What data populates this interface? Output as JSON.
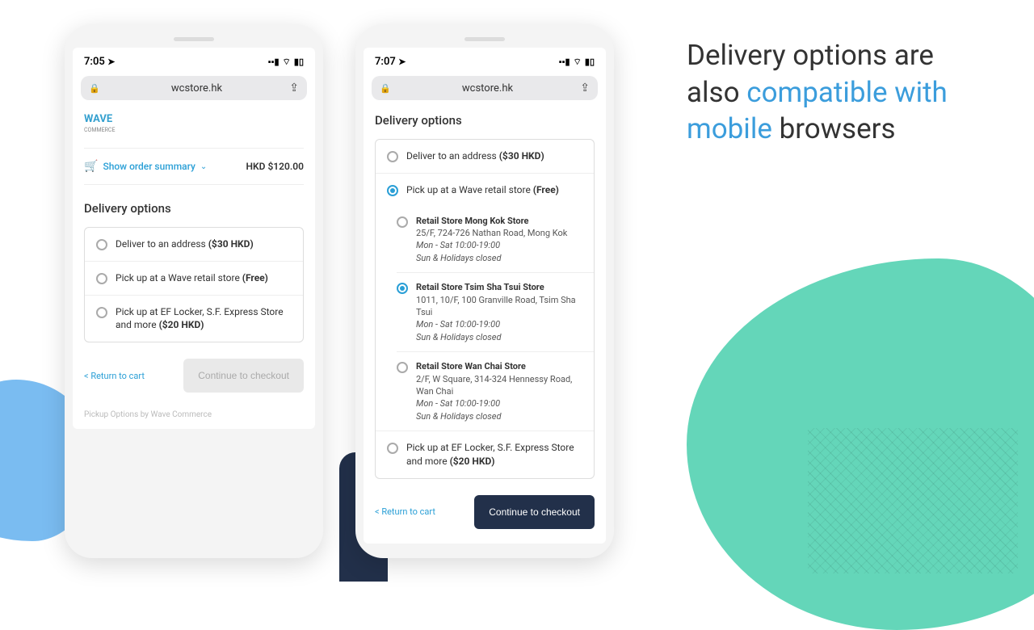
{
  "headline": {
    "part1": "Delivery options are also ",
    "accent": "compatible with mobile",
    "part2": " browsers"
  },
  "phone1": {
    "time": "7:05",
    "url": "wcstore.hk",
    "logo": "WAVE",
    "logo_sub": "COMMERCE",
    "summary_label": "Show order summary",
    "total": "HKD $120.00",
    "section_title": "Delivery options",
    "options": [
      {
        "label": "Deliver to an address ",
        "price": "($30 HKD)"
      },
      {
        "label": "Pick up at a Wave retail store ",
        "price": "(Free)"
      },
      {
        "label": "Pick up at EF Locker, S.F. Express Store and more ",
        "price": "($20 HKD)"
      }
    ],
    "return_label": "< Return to cart",
    "continue_label": "Continue to checkout",
    "footnote": "Pickup Options by Wave Commerce"
  },
  "phone2": {
    "time": "7:07",
    "url": "wcstore.hk",
    "section_title": "Delivery options",
    "deliver": {
      "label": "Deliver to an address ",
      "price": "($30 HKD)"
    },
    "pickup_wave": {
      "label": "Pick up at a Wave retail store ",
      "price": "(Free)"
    },
    "stores": [
      {
        "name": "Retail Store Mong Kok Store",
        "addr": "25/F, 724-726 Nathan Road, Mong Kok",
        "hours1": "Mon - Sat 10:00-19:00",
        "hours2": "Sun & Holidays closed"
      },
      {
        "name": "Retail Store Tsim Sha Tsui Store",
        "addr": "1011, 10/F, 100 Granville Road, Tsim Sha Tsui",
        "hours1": "Mon - Sat 10:00-19:00",
        "hours2": "Sun & Holidays closed"
      },
      {
        "name": "Retail Store Wan Chai Store",
        "addr": "2/F, W Square, 314-324 Hennessy Road, Wan Chai",
        "hours1": "Mon - Sat 10:00-19:00",
        "hours2": "Sun & Holidays closed"
      }
    ],
    "selected_store_index": 1,
    "ef_locker": {
      "label": "Pick up at EF Locker, S.F. Express Store and more ",
      "price": "($20 HKD)"
    },
    "return_label": "< Return to cart",
    "continue_label": "Continue to checkout"
  }
}
